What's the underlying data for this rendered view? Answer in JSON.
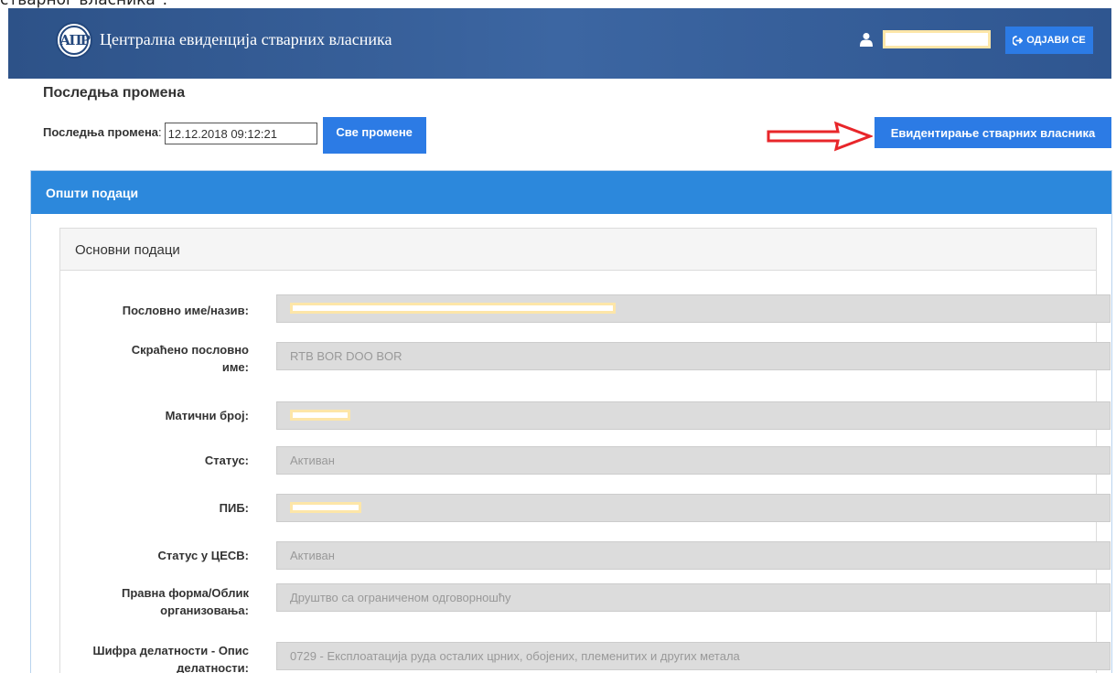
{
  "caption": "стварног власника\".",
  "header": {
    "app_title": "Централна евиденција стварних власника",
    "logo_text": "АПР",
    "logout_label": "ОДЈАВИ СЕ"
  },
  "page": {
    "heading": "Последња промена",
    "last_change_label": "Последња промена",
    "last_change_value": "12.12.2018 09:12:21",
    "all_changes_button": "Све промене",
    "register_button": "Евидентирање стварних власника"
  },
  "general_panel": {
    "title": "Општи подаци",
    "basic_panel": {
      "title": "Основни подаци",
      "fields": [
        {
          "label": "Пословно име/назив:",
          "value": ""
        },
        {
          "label": "Скраћено пословно име:",
          "value": "RTB BOR DOO BOR"
        },
        {
          "label": "Матични број:",
          "value": ""
        },
        {
          "label": "Статус:",
          "value": "Активан"
        },
        {
          "label": "ПИБ:",
          "value": ""
        },
        {
          "label": "Статус у ЦЕСВ:",
          "value": "Активан"
        },
        {
          "label": "Правна форма/Облик организовања:",
          "value": "Друштво са ограниченом одговорношћу"
        },
        {
          "label": "Шифра делатности - Опис делатности:",
          "value": "0729 - Експлоатација руда осталих црних, обојених, племенитих и других метала"
        }
      ]
    }
  },
  "colors": {
    "navbar": "#3c66a2",
    "button": "#2c7be5",
    "panel_header": "#2c88dc",
    "arrow": "#e8262a",
    "redaction_border": "#fde6a8"
  }
}
